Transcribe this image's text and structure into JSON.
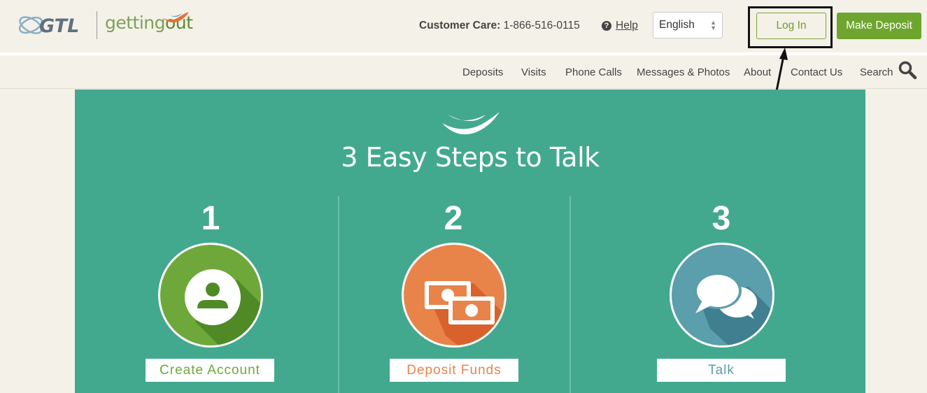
{
  "header": {
    "brand_gtl": "GTL",
    "brand_getting": "getting",
    "brand_out": "out",
    "customer_care_label": "Customer Care:",
    "customer_care_phone": "1-866-516-0115",
    "help_label": "Help",
    "language_selected": "English",
    "login_label": "Log In",
    "make_deposit_label": "Make Deposit"
  },
  "nav": {
    "items": [
      "Deposits",
      "Visits",
      "Phone Calls",
      "Messages & Photos",
      "About",
      "Contact Us",
      "Search"
    ]
  },
  "hero": {
    "title": "3 Easy Steps to Talk",
    "steps": [
      {
        "number": "1",
        "label": "Create Account",
        "icon": "user-icon",
        "color": "#6fa83a"
      },
      {
        "number": "2",
        "label": "Deposit Funds",
        "icon": "money-icon",
        "color": "#e8844a"
      },
      {
        "number": "3",
        "label": "Talk",
        "icon": "chat-bubbles-icon",
        "color": "#5b9eac"
      }
    ]
  },
  "colors": {
    "hero_bg": "#42a98f",
    "brand_green": "#6ea52e",
    "page_bg": "#f4f1e8"
  }
}
